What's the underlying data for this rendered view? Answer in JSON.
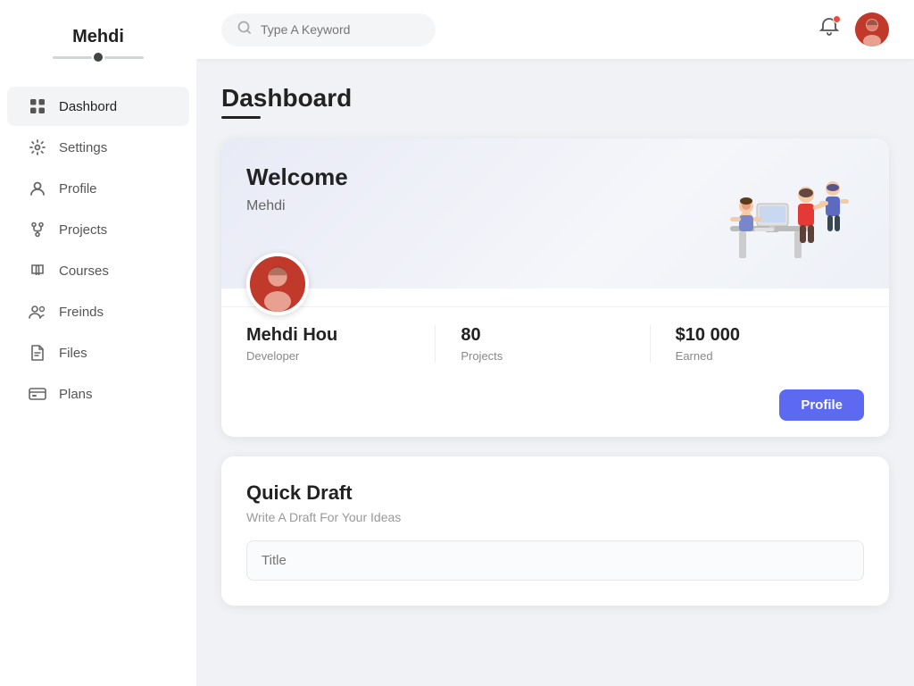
{
  "sidebar": {
    "username": "Mehdi",
    "nav_items": [
      {
        "id": "dashboard",
        "label": "Dashbord",
        "icon": "grid",
        "active": true
      },
      {
        "id": "settings",
        "label": "Settings",
        "icon": "settings"
      },
      {
        "id": "profile",
        "label": "Profile",
        "icon": "user"
      },
      {
        "id": "projects",
        "label": "Projects",
        "icon": "fork"
      },
      {
        "id": "courses",
        "label": "Courses",
        "icon": "book"
      },
      {
        "id": "freinds",
        "label": "Freinds",
        "icon": "people"
      },
      {
        "id": "files",
        "label": "Files",
        "icon": "file"
      },
      {
        "id": "plans",
        "label": "Plans",
        "icon": "card"
      }
    ]
  },
  "topbar": {
    "search_placeholder": "Type A Keyword"
  },
  "page": {
    "title": "Dashboard"
  },
  "welcome_card": {
    "heading": "Welcome",
    "subname": "Mehdi",
    "stat_name": "Mehdi Hou",
    "stat_role": "Developer",
    "stat_projects_value": "80",
    "stat_projects_label": "Projects",
    "stat_earned_value": "$10 000",
    "stat_earned_label": "Earned",
    "profile_btn": "Profile"
  },
  "quick_draft": {
    "title": "Quick Draft",
    "subtitle": "Write A Draft For Your Ideas",
    "title_placeholder": "Title"
  }
}
